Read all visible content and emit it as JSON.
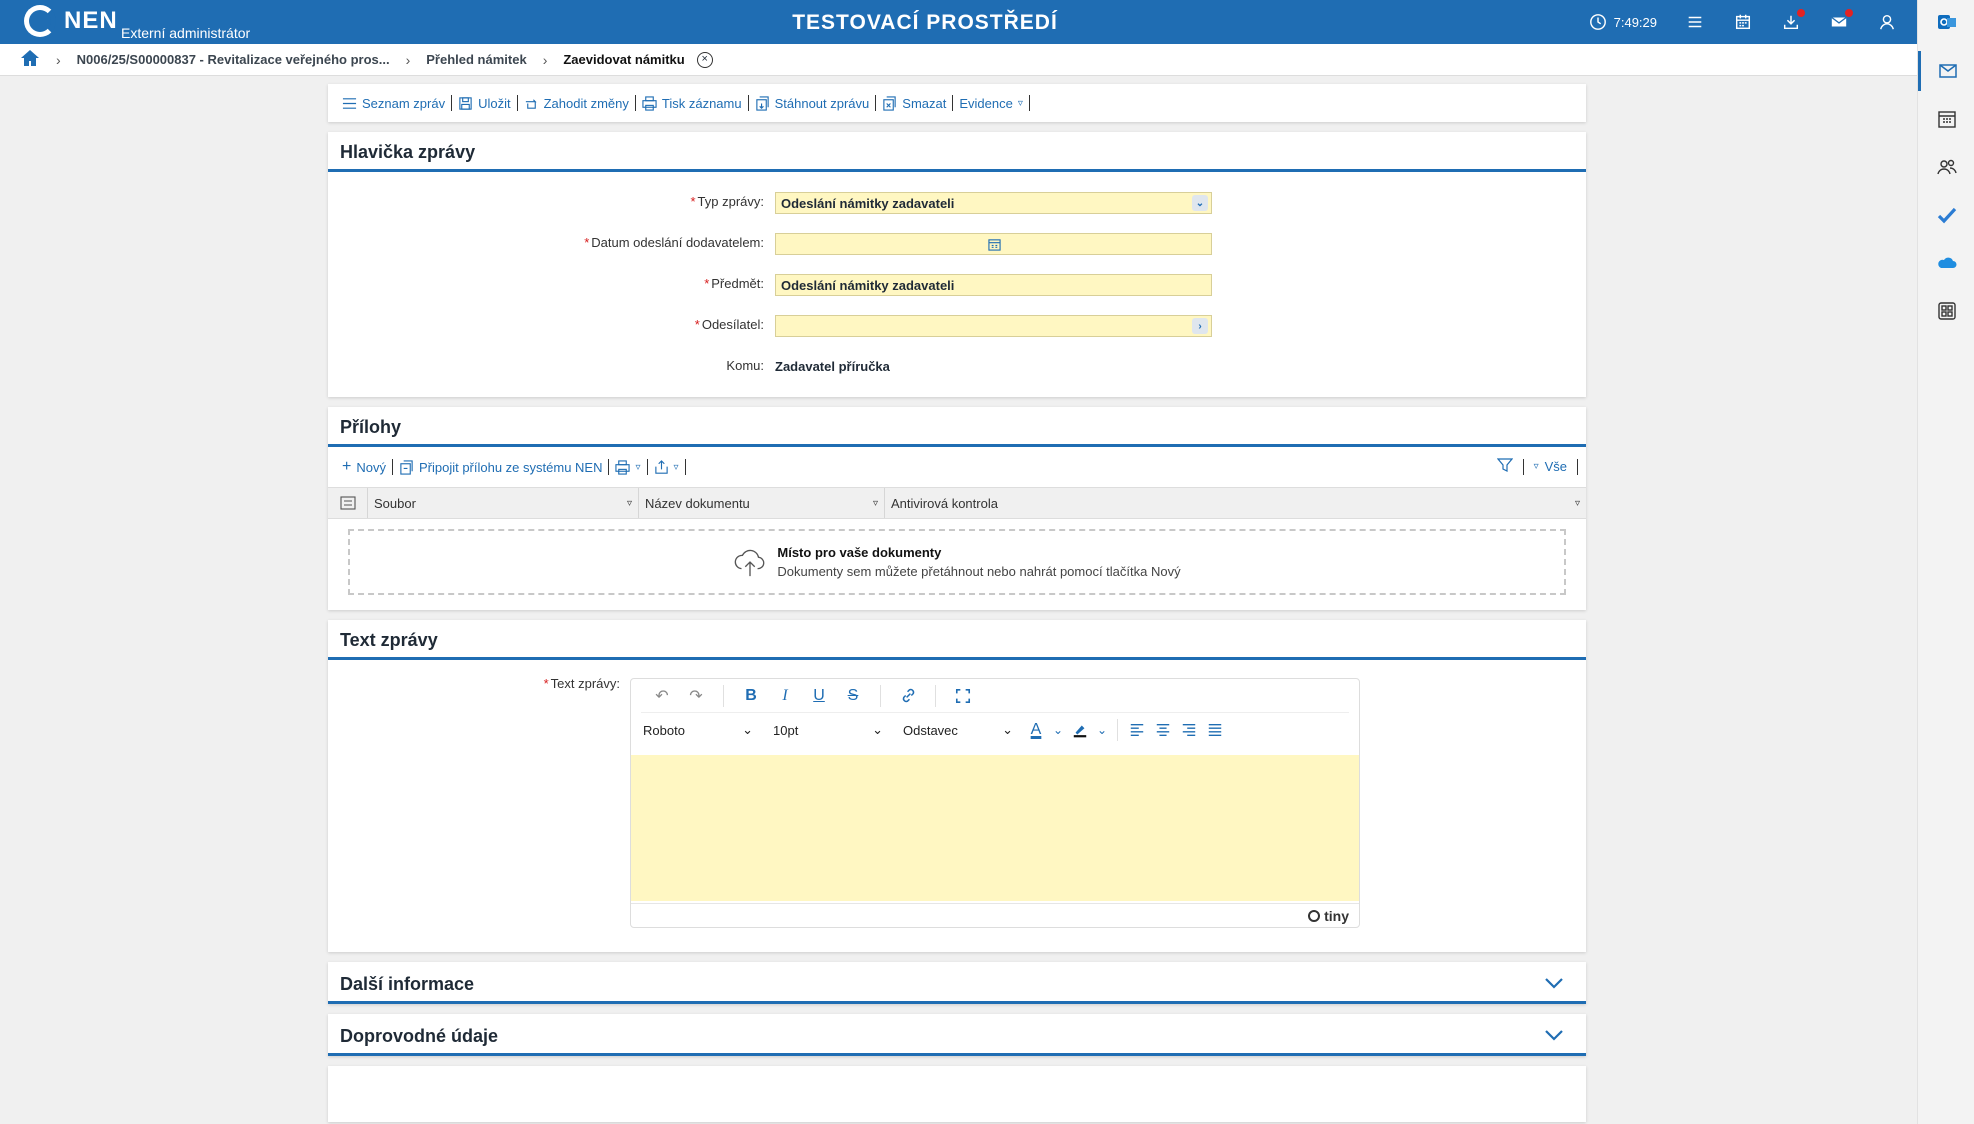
{
  "topbar": {
    "logo_text": "NEN",
    "subtitle": "Externí administrátor",
    "env_title": "TESTOVACÍ PROSTŘEDÍ",
    "clock": "7:49:29"
  },
  "breadcrumb": {
    "items": [
      "N006/25/S00000837 - Revitalizace veřejného pros...",
      "Přehled námitek"
    ],
    "current": "Zaevidovat námitku"
  },
  "toolbar": {
    "list": "Seznam zpráv",
    "save": "Uložit",
    "discard": "Zahodit změny",
    "print": "Tisk záznamu",
    "download": "Stáhnout zprávu",
    "delete": "Smazat",
    "evidence": "Evidence"
  },
  "header_section": {
    "title": "Hlavička zprávy",
    "fields": {
      "type_label": "Typ zprávy:",
      "type_value": "Odeslání námitky zadavateli",
      "date_label": "Datum odeslání dodavatelem:",
      "date_value": "",
      "subject_label": "Předmět:",
      "subject_value": "Odeslání námitky zadavateli",
      "sender_label": "Odesílatel:",
      "sender_value": "",
      "to_label": "Komu:",
      "to_value": "Zadavatel příručka"
    }
  },
  "attachments": {
    "title": "Přílohy",
    "new": "Nový",
    "attach_from_nen": "Připojit přílohu ze systému NEN",
    "filter_all": "Vše",
    "columns": [
      "Soubor",
      "Název dokumentu",
      "Antivirová kontrola"
    ],
    "dropzone_title": "Místo pro vaše dokumenty",
    "dropzone_sub": "Dokumenty sem můžete přetáhnout nebo nahrát pomocí tlačítka Nový"
  },
  "text_section": {
    "title": "Text zprávy",
    "label": "Text zprávy:",
    "font": "Roboto",
    "size": "10pt",
    "block": "Odstavec",
    "brand": "tiny"
  },
  "more_info": {
    "title": "Další informace"
  },
  "supporting": {
    "title": "Doprovodné údaje"
  },
  "colors": {
    "primary": "#1f6db3",
    "field_bg": "#fff7c2",
    "required": "#d61a1a"
  }
}
